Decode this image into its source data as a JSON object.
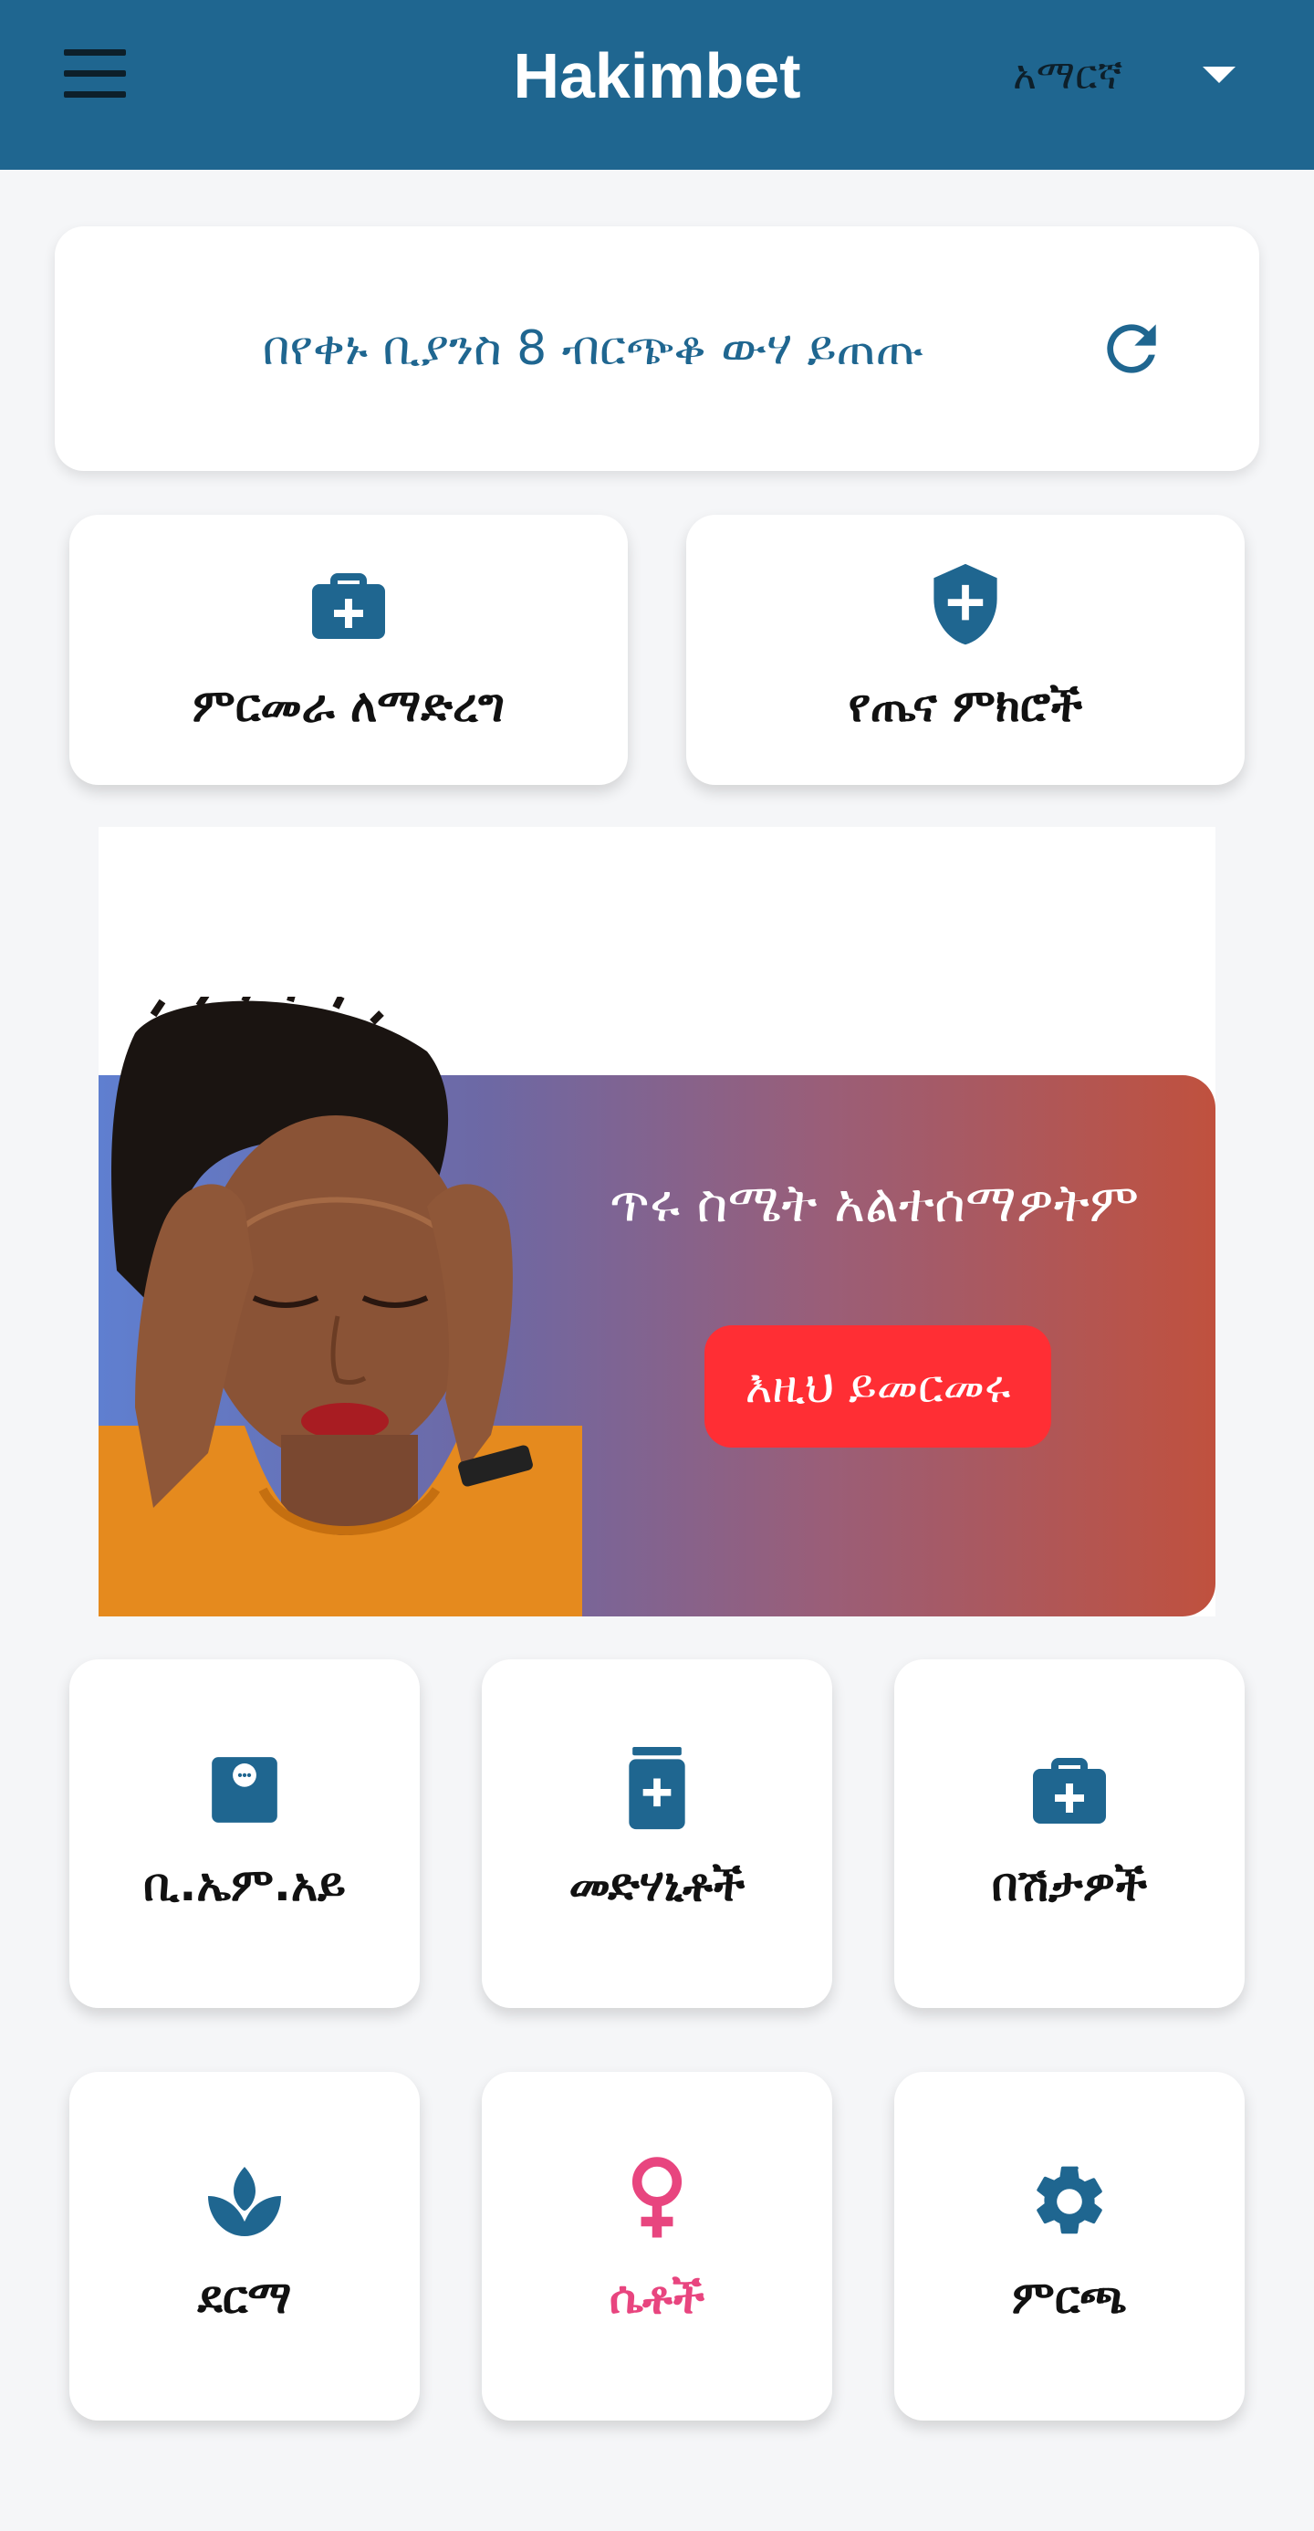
{
  "header": {
    "title": "Hakimbet",
    "language": "አማርኛ",
    "background": "#1f6690"
  },
  "tip": {
    "text": "በየቀኑ ቢያንስ 8 ብርጭቆ ውሃ ይጠጡ"
  },
  "quick_actions": [
    {
      "label": "ምርመራ ለማድረግ",
      "icon": "medical-bag-icon"
    },
    {
      "label": "የጤና ምክሮች",
      "icon": "shield-plus-icon"
    }
  ],
  "banner": {
    "heading": "ጥሩ ስሜት አልተሰማዎትም",
    "button": "እዚህ ይመርመሩ",
    "button_color": "#ff2e34"
  },
  "grid": [
    {
      "label": "ቢ.ኤም.አይ",
      "icon": "scale-icon"
    },
    {
      "label": "መድሃኒቶች",
      "icon": "medicine-bottle-icon"
    },
    {
      "label": "በሽታዎች",
      "icon": "medical-bag-icon"
    },
    {
      "label": "ደርማ",
      "icon": "spa-icon"
    },
    {
      "label": "ሴቶች",
      "icon": "female-icon",
      "color": "#e8457f"
    },
    {
      "label": "ምርጫ",
      "icon": "gear-icon"
    }
  ],
  "accent": "#1f6690"
}
